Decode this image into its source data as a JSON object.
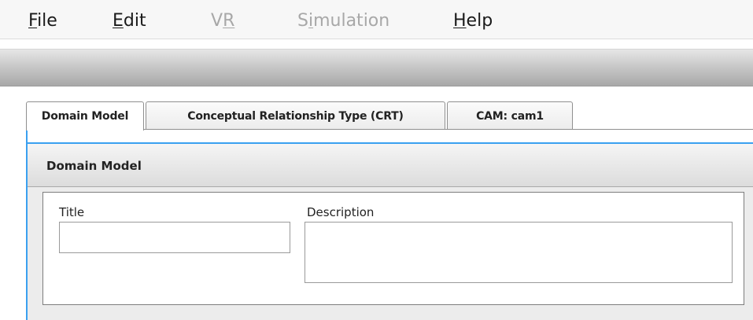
{
  "menubar": {
    "items": [
      {
        "mnemonic": "F",
        "rest": "ile",
        "enabled": true
      },
      {
        "mnemonic": "E",
        "rest": "dit",
        "enabled": true
      },
      {
        "pre": "V",
        "mnemonic": "R",
        "rest": "",
        "enabled": false
      },
      {
        "pre": "S",
        "mnemonic": "i",
        "rest": "mulation",
        "enabled": false
      },
      {
        "mnemonic": "H",
        "rest": "elp",
        "enabled": true
      }
    ]
  },
  "tabs": [
    {
      "label": "Domain Model",
      "active": true
    },
    {
      "label": "Conceptual Relationship Type (CRT)",
      "active": false
    },
    {
      "label": "CAM: cam1",
      "active": false
    }
  ],
  "panel": {
    "title": "Domain Model",
    "fields": {
      "title_label": "Title",
      "title_value": "",
      "description_label": "Description",
      "description_value": ""
    }
  },
  "colors": {
    "accent": "#3aa0f0",
    "disabled_text": "#a8a8a8"
  }
}
